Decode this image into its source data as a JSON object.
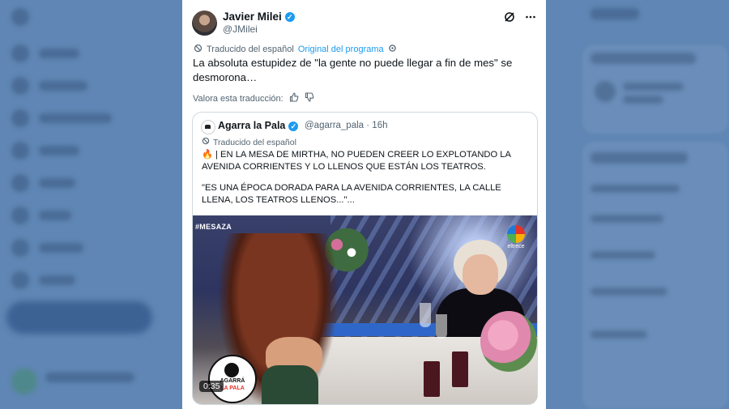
{
  "tweet": {
    "author_name": "Javier Milei",
    "author_handle": "@JMilei",
    "translated_label": "Traducido del español",
    "original_label": "Original del programa",
    "text": "La absoluta estupidez de \"la gente no puede llegar a fin de mes\" se desmorona…",
    "rate_translation_label": "Valora esta traducción:"
  },
  "quote": {
    "author_name": "Agarra la Pala",
    "author_handle": "@agarra_pala",
    "time": "16h",
    "translated_label": "Traducido del español",
    "paragraph1": "🔥 | EN LA MESA DE MIRTHA, NO PUEDEN CREER LO EXPLOTANDO LA AVENIDA CORRIENTES Y LO LLENOS QUE ESTÁN LOS TEATROS.",
    "paragraph2": "\"ES UNA ÉPOCA DORADA PARA LA AVENIDA CORRIENTES, LA CALLE LLENA, LOS TEATROS LLENOS...\"...",
    "media": {
      "hashtag_overlay": "#MESAZA",
      "channel_logo_label": "eltrece",
      "badge_line1": "AGARRÁ",
      "badge_line2": "LA PALA",
      "duration": "0:35"
    }
  },
  "icons": {
    "verified": "verified-badge-icon",
    "grok": "grok-icon",
    "more": "more-icon",
    "translate": "translate-icon",
    "settings": "gear-icon",
    "thumbs_up": "thumbs-up-icon",
    "thumbs_down": "thumbs-down-icon"
  },
  "colors": {
    "accent": "#1d9bf0",
    "background": "#5f86b4"
  }
}
